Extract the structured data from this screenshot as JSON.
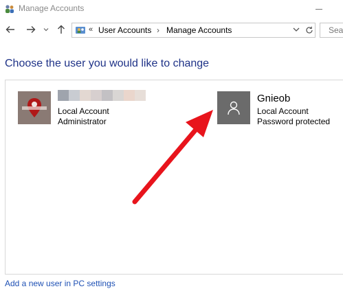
{
  "window": {
    "title": "Manage Accounts",
    "app_icon": "users-group-icon",
    "minimize_icon": "minimize-icon"
  },
  "nav": {
    "back_icon": "back-arrow-icon",
    "forward_icon": "forward-arrow-icon",
    "recent_icon": "chevron-down-icon",
    "up_icon": "up-arrow-icon",
    "address": {
      "overflow_chevron": "«",
      "crumbs": [
        "User Accounts",
        "Manage Accounts"
      ],
      "separator": "›",
      "dropdown_icon": "chevron-down-icon"
    },
    "refresh_icon": "refresh-icon",
    "search_placeholder": "Sear"
  },
  "heading": "Choose the user you would like to change",
  "accounts": [
    {
      "name": "",
      "name_hidden": true,
      "type": "Local Account",
      "status": "Administrator",
      "picture": "custom-image-avatar"
    },
    {
      "name": "Gnieob",
      "type": "Local Account",
      "status": "Password protected",
      "picture": "default-user-icon"
    }
  ],
  "annotation": {
    "arrow_color": "#e8141c",
    "icon": "red-arrow-icon"
  },
  "footer": {
    "add_user_link": "Add a new user in PC settings"
  },
  "colors": {
    "heading": "#1e3287",
    "link": "#1e50b4",
    "default_avatar_bg": "#6b6b6b"
  }
}
